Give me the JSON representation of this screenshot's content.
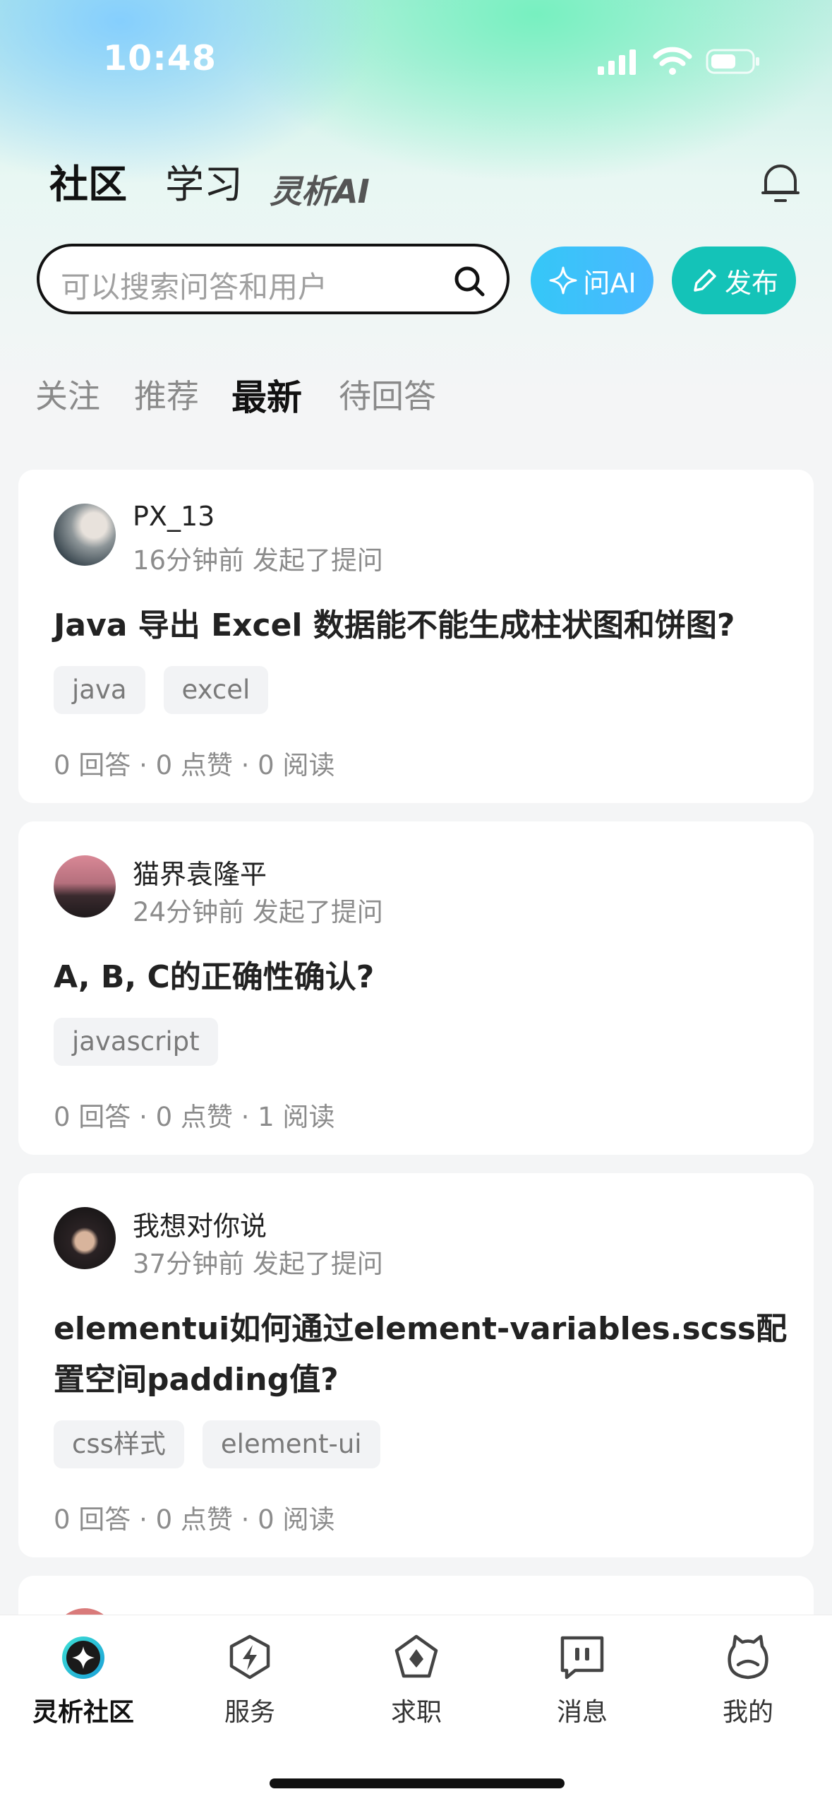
{
  "status_bar": {
    "time": "10:48"
  },
  "top_nav": {
    "tabs": [
      {
        "label": "社区",
        "active": true
      },
      {
        "label": "学习",
        "active": false
      },
      {
        "label": "灵析AI",
        "active": false
      }
    ],
    "accent_color": "#1ccfc4"
  },
  "search": {
    "placeholder": "可以搜索问答和用户",
    "ask_ai_label": "问AI",
    "publish_label": "发布"
  },
  "feed_tabs": [
    {
      "label": "关注",
      "active": false
    },
    {
      "label": "推荐",
      "active": false
    },
    {
      "label": "最新",
      "active": true
    },
    {
      "label": "待回答",
      "active": false
    }
  ],
  "posts": [
    {
      "username": "PX_13",
      "meta": "16分钟前 发起了提问",
      "title": "Java 导出 Excel 数据能不能生成柱状图和饼图?",
      "tags": [
        "java",
        "excel"
      ],
      "stats": "0 回答 · 0 点赞 · 0 阅读"
    },
    {
      "username": "猫界袁隆平",
      "meta": "24分钟前 发起了提问",
      "title": "A, B, C的正确性确认?",
      "tags": [
        "javascript"
      ],
      "stats": "0 回答 · 0 点赞 · 1 阅读"
    },
    {
      "username": "我想对你说",
      "meta": "37分钟前 发起了提问",
      "title": "elementui如何通过element-variables.scss配置空间padding值?",
      "tags": [
        "css样式",
        "element-ui"
      ],
      "stats": "0 回答 · 0 点赞 · 0 阅读"
    }
  ],
  "bottom_tabs": [
    {
      "label": "灵析社区",
      "icon": "community-star-icon",
      "active": true
    },
    {
      "label": "服务",
      "icon": "lightning-shield-icon",
      "active": false
    },
    {
      "label": "求职",
      "icon": "job-diamond-icon",
      "active": false
    },
    {
      "label": "消息",
      "icon": "message-icon",
      "active": false
    },
    {
      "label": "我的",
      "icon": "profile-cat-icon",
      "active": false
    }
  ]
}
